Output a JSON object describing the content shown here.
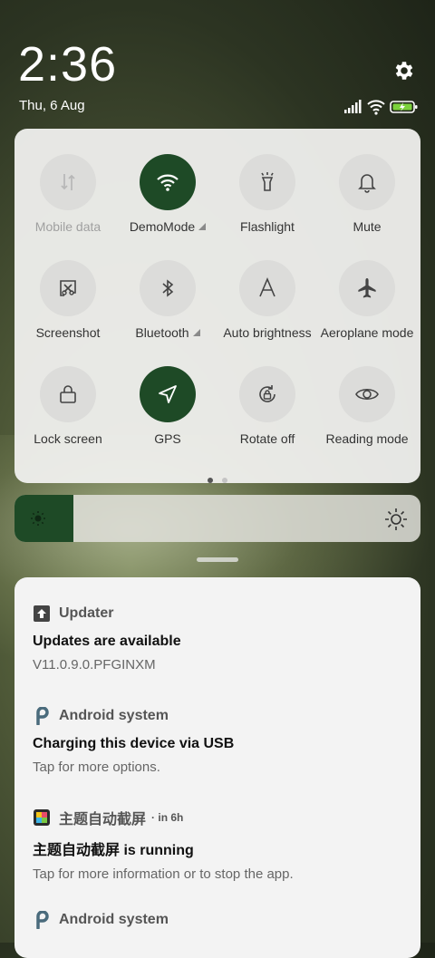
{
  "status": {
    "time": "2:36",
    "date": "Thu, 6 Aug"
  },
  "quick_settings": {
    "tiles": [
      {
        "label": "Mobile data",
        "active": false,
        "disabled": true,
        "icon": "mobile-data-icon"
      },
      {
        "label": "DemoMode",
        "active": true,
        "expandable": true,
        "icon": "wifi-icon"
      },
      {
        "label": "Flashlight",
        "active": false,
        "icon": "flashlight-icon"
      },
      {
        "label": "Mute",
        "active": false,
        "icon": "bell-icon"
      },
      {
        "label": "Screenshot",
        "active": false,
        "icon": "screenshot-icon"
      },
      {
        "label": "Bluetooth",
        "active": false,
        "expandable": true,
        "icon": "bluetooth-icon"
      },
      {
        "label": "Auto brightness",
        "active": false,
        "icon": "auto-brightness-icon"
      },
      {
        "label": "Aeroplane mode",
        "active": false,
        "icon": "airplane-icon"
      },
      {
        "label": "Lock screen",
        "active": false,
        "icon": "lock-icon"
      },
      {
        "label": "GPS",
        "active": true,
        "icon": "location-arrow-icon"
      },
      {
        "label": "Rotate off",
        "active": false,
        "icon": "rotate-lock-icon"
      },
      {
        "label": "Reading mode",
        "active": false,
        "icon": "eye-icon"
      }
    ],
    "page_count": 2,
    "current_page": 1
  },
  "brightness": {
    "level": 0.145,
    "accent": "#1e4a26"
  },
  "notifications": [
    {
      "app": "Updater",
      "time": "",
      "title": "Updates are available",
      "body": "V11.0.9.0.PFGINXM",
      "icon": "upload-arrow-icon"
    },
    {
      "app": "Android system",
      "time": "",
      "title": "Charging this device via USB",
      "body": "Tap for more options.",
      "icon": "android-p-icon"
    },
    {
      "app": "主题自动截屏",
      "time": "in 6h",
      "title": "主题自动截屏 is running",
      "body": "Tap for more information or to stop the app.",
      "icon": "theme-app-icon"
    },
    {
      "app": "Android system",
      "time": "",
      "title": "",
      "body": "",
      "icon": "android-p-icon"
    }
  ],
  "colors": {
    "active_tile": "#1e4a26",
    "inactive_tile": "#dcdcda",
    "battery": "#7cd23c"
  }
}
